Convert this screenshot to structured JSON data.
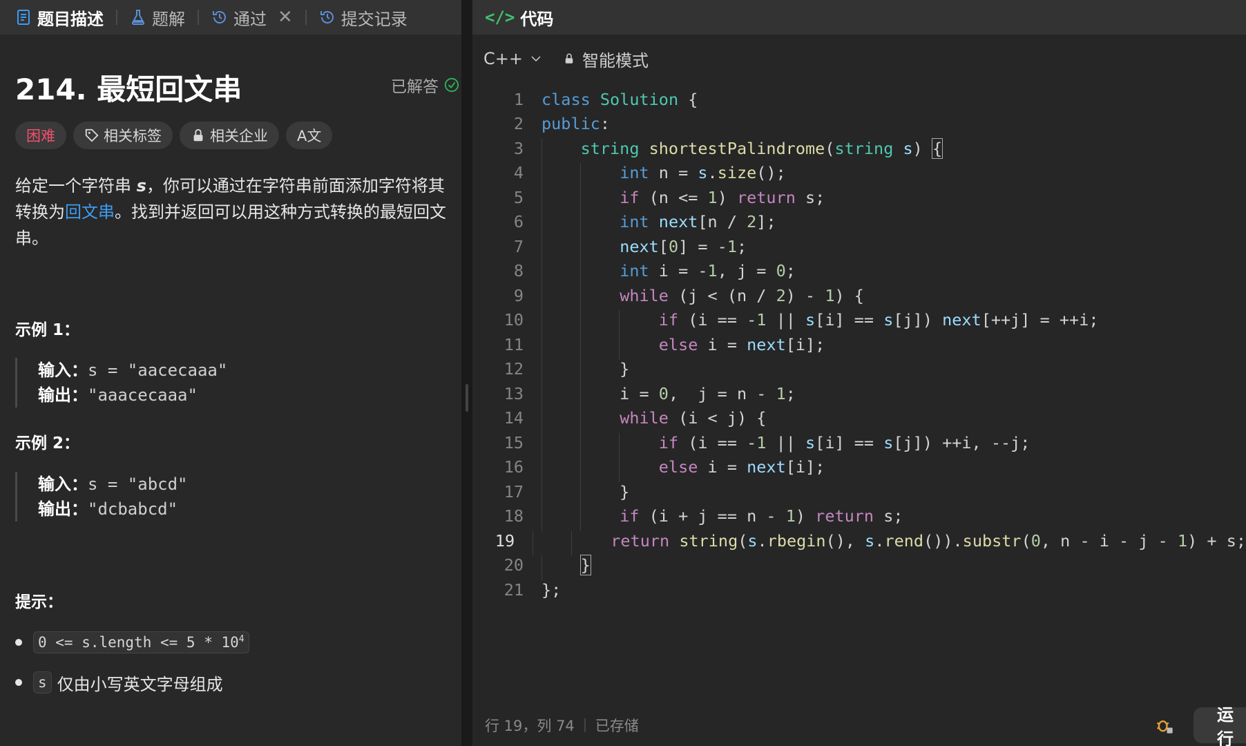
{
  "left_tabs": [
    {
      "label": "题目描述",
      "icon": "document-icon",
      "active": true
    },
    {
      "label": "题解",
      "icon": "flask-icon",
      "active": false
    },
    {
      "label": "通过",
      "icon": "history-icon",
      "active": false
    },
    {
      "label": "提交记录",
      "icon": "history-icon",
      "active": false
    }
  ],
  "tab_close": "✕",
  "problem": {
    "title": "214. 最短回文串",
    "status": "已解答",
    "tags": [
      "困难",
      "相关标签",
      "相关企业",
      "A文"
    ],
    "description_part1": "给定一个字符串 ",
    "description_var": "s",
    "description_part2": "，你可以通过在字符串前面添加字符将其转换为",
    "description_link": "回文串",
    "description_part3": "。找到并返回可以用这种方式转换的最短回文串。"
  },
  "examples": [
    {
      "title": "示例 1：",
      "input_label": "输入：",
      "input": "s = \"aacecaaa\"",
      "output_label": "输出：",
      "output": "\"aaacecaaa\""
    },
    {
      "title": "示例 2：",
      "input_label": "输入：",
      "input": "s = \"abcd\"",
      "output_label": "输出：",
      "output": "\"dcbabcd\""
    }
  ],
  "hints_title": "提示：",
  "hints": [
    {
      "code": "0 <= s.length <= 5 * 10",
      "sup": "4",
      "text": ""
    },
    {
      "code": "s",
      "sup": "",
      "text": "仅由小写英文字母组成"
    }
  ],
  "code_panel": {
    "title_icon": "</>",
    "title": "代码",
    "language": "C++",
    "mode": "智能模式"
  },
  "status_bar": {
    "position": "行 19，列 74",
    "saved": "已存储",
    "run_label": "运行"
  },
  "current_line": 19
}
